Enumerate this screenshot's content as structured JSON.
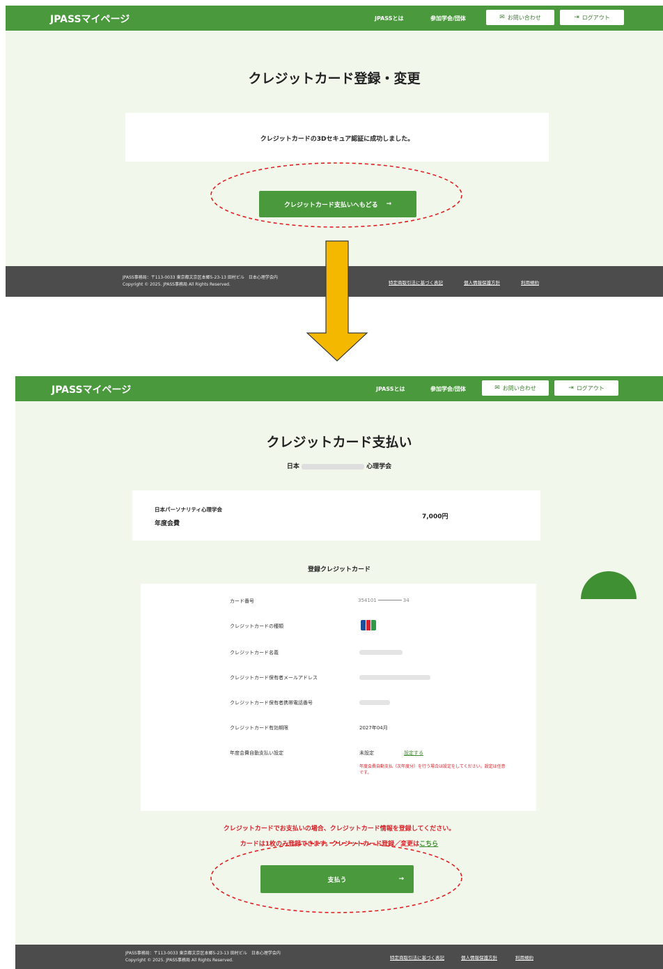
{
  "shot1": {
    "header": {
      "logo": "JPASSマイページ",
      "nav_about": "JPASSとは",
      "nav_societies": "参加学会/団体",
      "contact_label": "お問い合わせ",
      "logout_label": "ログアウト"
    },
    "title": "クレジットカード登録・変更",
    "message": "クレジットカードの3Dセキュア認証に成功しました。",
    "back_button": "クレジットカード支払いへもどる",
    "footer": {
      "address": "JPASS事務局：〒113-0033 東京都文京区本郷5-23-13 田村ビル　日本心理学会内",
      "copyright": "Copyright © 2025. JPASS事務局 All Rights Reserved.",
      "links": [
        "特定商取引法に基づく表記",
        "個人情報保護方針",
        "利用規約"
      ]
    }
  },
  "shot2": {
    "header": {
      "logo": "JPASSマイページ",
      "nav_about": "JPASSとは",
      "nav_societies": "参加学会/団体",
      "contact_label": "お問い合わせ",
      "logout_label": "ログアウト"
    },
    "title": "クレジットカード支払い",
    "society_prefix": "日本",
    "society_suffix": "心理学会",
    "item": {
      "society": "日本パーソナリティ心理学会",
      "name": "年度会費",
      "amount": "7,000円"
    },
    "card_section_title": "登録クレジットカード",
    "rows": [
      {
        "label": "カード番号",
        "value": "354101"
      },
      {
        "label": "クレジットカードの種類",
        "value": ""
      },
      {
        "label": "クレジットカード名義",
        "value": ""
      },
      {
        "label": "クレジットカード保有者メールアドレス",
        "value": ""
      },
      {
        "label": "クレジットカード保有者携帯電話番号",
        "value": ""
      },
      {
        "label": "クレジットカード有効期限",
        "value": "2027年04月"
      },
      {
        "label": "年度会費自動支払い設定",
        "value": "未設定",
        "link": "設定する"
      }
    ],
    "auto_pay_note": "年度会費自動支払（次年度分）を行う場合は設定をしてください。設定は任意です。",
    "notice_line1": "クレジットカードでお支払いの場合、クレジットカード情報を登録してください。",
    "notice_line2": "カードは1枚のみ登録できます。クレジットカード登録／変更は",
    "notice_link": "こちら",
    "pay_button": "支払う",
    "footer": {
      "address": "JPASS事務局：〒113-0033 東京都文京区本郷5-23-13 田村ビル　日本心理学会内",
      "copyright": "Copyright © 2025. JPASS事務局 All Rights Reserved.",
      "links": [
        "特定商取引法に基づく表記",
        "個人情報保護方針",
        "利用規約"
      ]
    }
  },
  "colors": {
    "header_green": "#4a9a3d",
    "highlight": "#e02020",
    "arrow": "#f5b800",
    "footer": "#4c4c4c"
  }
}
